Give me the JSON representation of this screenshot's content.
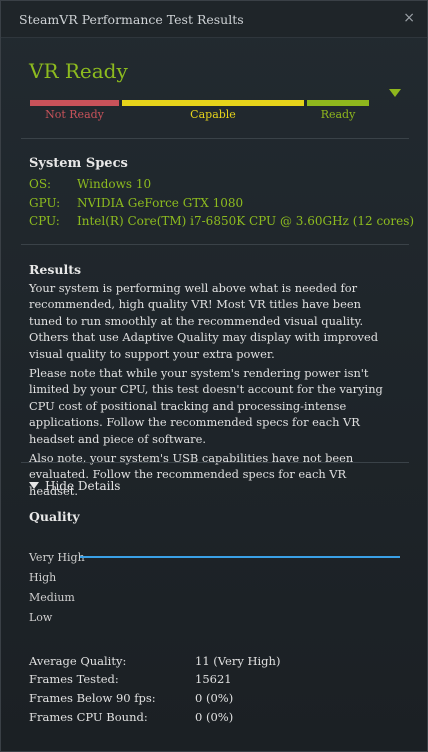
{
  "window": {
    "title": "SteamVR Performance Test Results",
    "close_glyph": "×"
  },
  "status": {
    "headline": "VR Ready",
    "headline_color": "#8dbb1f",
    "scale": [
      {
        "label": "Not Ready",
        "color": "#c8525a"
      },
      {
        "label": "Capable",
        "color": "#e6d31a"
      },
      {
        "label": "Ready",
        "color": "#8fb71d"
      }
    ]
  },
  "specs": {
    "heading": "System Specs",
    "os_label": "OS:",
    "os_value": "Windows 10",
    "gpu_label": "GPU:",
    "gpu_value": "NVIDIA GeForce GTX 1080",
    "cpu_label": "CPU:",
    "cpu_value": "Intel(R) Core(TM) i7-6850K CPU @ 3.60GHz (12 cores)"
  },
  "results": {
    "heading": "Results",
    "p1": "Your system is performing well above what is needed for recommended, high quality VR! Most VR titles have been tuned to run smoothly at the recommended visual quality. Others that use Adaptive Quality may display with improved visual quality to support your extra power.",
    "p2": "Please note that while your system's rendering power isn't limited by your CPU, this test doesn't account for the varying CPU cost of positional tracking and processing-intense applications. Follow the recommended specs for each VR headset and piece of software.",
    "p3": "Also note, your system's USB capabilities have not been evaluated. Follow the recommended specs for each VR headset."
  },
  "details": {
    "toggle_label": "Hide Details",
    "quality_heading": "Quality",
    "levels": [
      "Very High",
      "High",
      "Medium",
      "Low"
    ],
    "line_color": "#3aa0e6",
    "stats": {
      "avg_label": "Average Quality:",
      "avg_value": "11 (Very High)",
      "frames_label": "Frames Tested:",
      "frames_value": "15621",
      "below_label": "Frames Below 90 fps:",
      "below_value": "0 (0%)",
      "cpu_label": "Frames CPU Bound:",
      "cpu_value": "0 (0%)"
    }
  }
}
